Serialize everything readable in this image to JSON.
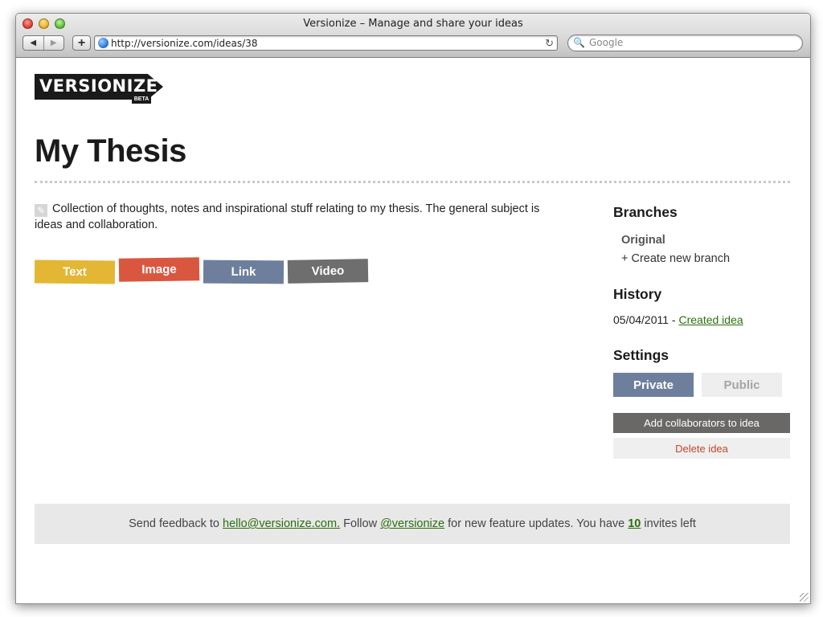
{
  "browser": {
    "window_title": "Versionize – Manage and share your ideas",
    "back_glyph": "◀",
    "forward_glyph": "▶",
    "add_glyph": "+",
    "url": "http://versionize.com/ideas/38",
    "reload_glyph": "↻",
    "search_icon_glyph": "🔍",
    "search_placeholder": "Google"
  },
  "brand": {
    "logo_text": "VERSIONIZE",
    "beta_label": "BETA"
  },
  "idea": {
    "title": "My Thesis",
    "edit_glyph": "✎",
    "description": "Collection of thoughts, notes and inspirational stuff relating to my thesis. The general subject is ideas and collaboration."
  },
  "add_types": [
    {
      "label": "Text",
      "color": "#e3b634"
    },
    {
      "label": "Image",
      "color": "#d9573f"
    },
    {
      "label": "Link",
      "color": "#6d7f9d"
    },
    {
      "label": "Video",
      "color": "#6e6e6e"
    }
  ],
  "sidebar": {
    "branches": {
      "heading": "Branches",
      "original": "Original",
      "create_new": "+ Create new branch"
    },
    "history": {
      "heading": "History",
      "entries": [
        {
          "date": "05/04/2011",
          "separator": " - ",
          "action": "Created idea"
        }
      ]
    },
    "settings": {
      "heading": "Settings",
      "private_label": "Private",
      "public_label": "Public",
      "selected_visibility": "Private",
      "collaborators_label": "Add collaborators to idea",
      "delete_label": "Delete idea"
    }
  },
  "footer": {
    "part1": "Send feedback to ",
    "email": "hello@versionize.com.",
    "part2": " Follow ",
    "twitter": "@versionize",
    "part3": " for new feature updates. You have ",
    "invites_count": "10",
    "part4": " invites left"
  },
  "colors": {
    "accent_link": "#2c6e0e",
    "private_button": "#6d7f9d",
    "delete_text": "#c0462c"
  }
}
